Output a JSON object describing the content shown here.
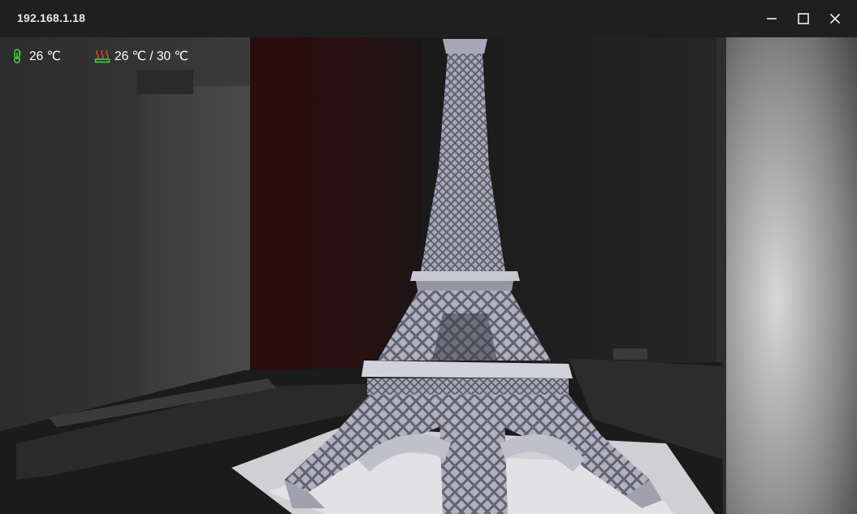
{
  "window": {
    "title": "192.168.1.18",
    "minimize_icon": "minimize-icon",
    "maximize_icon": "maximize-icon",
    "close_icon": "close-icon"
  },
  "overlay": {
    "chamber_temp": "26 ℃",
    "chamber_icon": "thermometer-icon",
    "bed_temp": "26 ℃ / 30 ℃",
    "bed_icon": "heated-bed-icon",
    "icon_color": "#3ecf3a"
  },
  "feed": {
    "subject": "camera-feed"
  }
}
